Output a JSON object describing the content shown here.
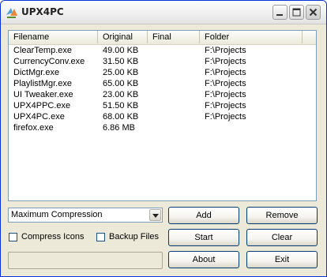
{
  "window": {
    "title": "UPX4PC"
  },
  "file_list": {
    "columns": [
      "Filename",
      "Original",
      "Final",
      "Folder"
    ],
    "rows": [
      {
        "filename": "ClearTemp.exe",
        "original": "49.00 KB",
        "final": "",
        "folder": "F:\\Projects"
      },
      {
        "filename": "CurrencyConv.exe",
        "original": "31.50 KB",
        "final": "",
        "folder": "F:\\Projects"
      },
      {
        "filename": "DictMgr.exe",
        "original": "25.00 KB",
        "final": "",
        "folder": "F:\\Projects"
      },
      {
        "filename": "PlaylistMgr.exe",
        "original": "65.00 KB",
        "final": "",
        "folder": "F:\\Projects"
      },
      {
        "filename": "UI Tweaker.exe",
        "original": "23.00 KB",
        "final": "",
        "folder": "F:\\Projects"
      },
      {
        "filename": "UPX4PPC.exe",
        "original": "51.50 KB",
        "final": "",
        "folder": "F:\\Projects"
      },
      {
        "filename": "UPX4PC.exe",
        "original": "68.00 KB",
        "final": "",
        "folder": "F:\\Projects"
      },
      {
        "filename": "firefox.exe",
        "original": "6.86 MB",
        "final": "",
        "folder": ""
      }
    ]
  },
  "compression": {
    "selected": "Maximum Compression"
  },
  "options": {
    "compress_icons": "Compress Icons",
    "backup_files": "Backup Files"
  },
  "buttons": {
    "add": "Add",
    "remove": "Remove",
    "start": "Start",
    "clear": "Clear",
    "about": "About",
    "exit": "Exit"
  },
  "progress": {
    "value": 0
  },
  "icons": {
    "app": "upx-app-icon",
    "minimize": "minimize-icon",
    "maximize": "maximize-icon",
    "close": "close-icon",
    "dropdown": "chevron-down-icon"
  },
  "colors": {
    "window_border": "#0831d9",
    "face": "#ece9d8",
    "list_border": "#7f9db9"
  }
}
